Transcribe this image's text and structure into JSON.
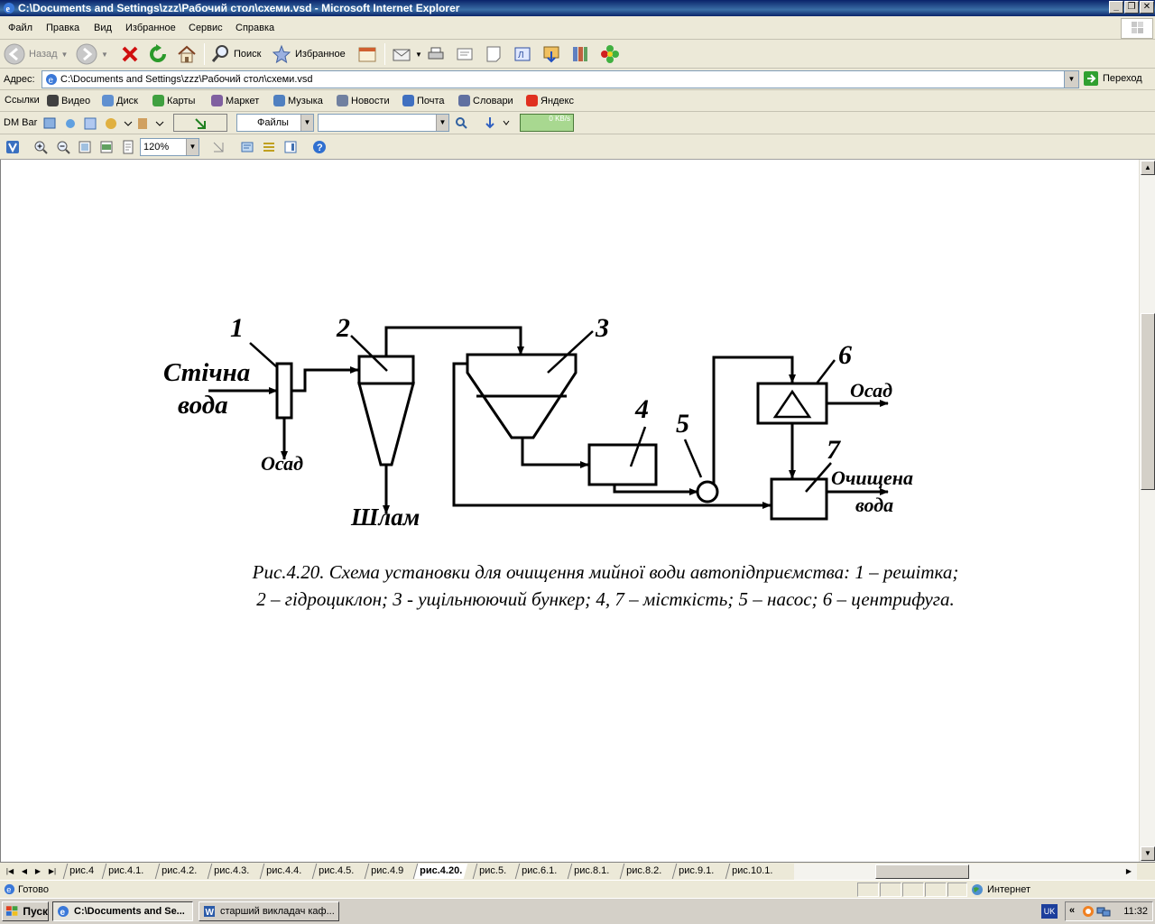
{
  "window": {
    "title": "C:\\Documents and Settings\\zzz\\Рабочий стол\\схеми.vsd - Microsoft Internet Explorer"
  },
  "menu": [
    "Файл",
    "Правка",
    "Вид",
    "Избранное",
    "Сервис",
    "Справка"
  ],
  "toolbar": {
    "back": "Назад",
    "search": "Поиск",
    "favorites": "Избранное"
  },
  "address": {
    "label": "Адрес:",
    "value": "C:\\Documents and Settings\\zzz\\Рабочий стол\\схеми.vsd",
    "go": "Переход"
  },
  "links": {
    "label": "Ссылки",
    "items": [
      "Видео",
      "Диск",
      "Карты",
      "Маркет",
      "Музыка",
      "Новости",
      "Почта",
      "Словари",
      "Яндекс"
    ]
  },
  "dmbar": {
    "label": "DM Bar",
    "files": "Файлы",
    "speed": "0 KB/s"
  },
  "visio": {
    "zoom": "120%"
  },
  "diagram": {
    "labels": {
      "n1": "1",
      "n2": "2",
      "n3": "3",
      "n4": "4",
      "n5": "5",
      "n6": "6",
      "n7": "7",
      "inflow_line1": "Стічна",
      "inflow_line2": "вода",
      "sediment1": "Осад",
      "sludge": "Шлам",
      "sediment6": "Осад",
      "clean_line1": "Очищена",
      "clean_line2": "вода"
    },
    "caption_line1": "Рис.4.20. Схема установки для очищення мийної води автопідприємства: 1 – решітка;",
    "caption_line2": "2 – гідроциклон; 3 - ущільнюючий бункер; 4, 7 – місткість; 5 – насос; 6 – центрифуга."
  },
  "sheet_tabs": [
    "рис.4",
    "рис.4.1.",
    "рис.4.2.",
    "рис.4.3.",
    "рис.4.4.",
    "рис.4.5.",
    "рис.4.9",
    "рис.4.20.",
    "рис.5.",
    "рис.6.1.",
    "рис.8.1.",
    "рис.8.2.",
    "рис.9.1.",
    "рис.10.1."
  ],
  "active_tab": "рис.4.20.",
  "status": {
    "text": "Готово",
    "zone": "Интернет"
  },
  "taskbar": {
    "start": "Пуск",
    "tasks": [
      "C:\\Documents and Se...",
      "старший викладач каф..."
    ],
    "lang": "UK",
    "clock": "11:32"
  }
}
